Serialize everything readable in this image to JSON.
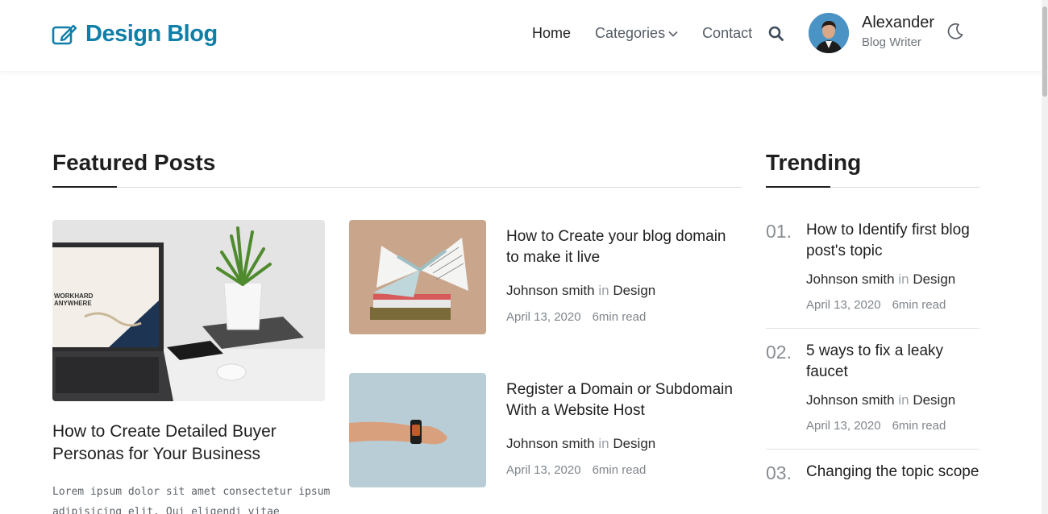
{
  "brand": {
    "name": "Design Blog",
    "icon": "edit-square-icon",
    "color": "#0f7fa8"
  },
  "nav": {
    "items": [
      {
        "label": "Home"
      },
      {
        "label": "Categories",
        "icon": "chevron-down-icon"
      },
      {
        "label": "Contact"
      }
    ],
    "search_icon": "search-icon"
  },
  "user": {
    "name": "Alexander",
    "role": "Blog Writer",
    "theme_icon": "moon-icon"
  },
  "featured": {
    "heading": "Featured Posts",
    "main": {
      "title": "How to Create Detailed Buyer Personas for Your Business",
      "excerpt": "Lorem ipsum dolor sit amet consectetur ipsum adipisicing elit. Qui eligendi vitae",
      "laptop_screen_text": "WORKHARD ANYWHERE"
    },
    "posts": [
      {
        "title": "How to Create your blog domain to make it live",
        "author": "Johnson smith",
        "in": "in",
        "category": "Design",
        "date": "April 13, 2020",
        "read": "6min read"
      },
      {
        "title": "Register a Domain or Subdomain With a Website Host",
        "author": "Johnson smith",
        "in": "in",
        "category": "Design",
        "date": "April 13, 2020",
        "read": "6min read"
      }
    ]
  },
  "trending": {
    "heading": "Trending",
    "items": [
      {
        "num": "01.",
        "title": "How to Identify first blog post's topic",
        "author": "Johnson smith",
        "in": "in",
        "category": "Design",
        "date": "April 13, 2020",
        "read": "6min read"
      },
      {
        "num": "02.",
        "title": "5 ways to fix a leaky faucet",
        "author": "Johnson smith",
        "in": "in",
        "category": "Design",
        "date": "April 13, 2020",
        "read": "6min read"
      },
      {
        "num": "03.",
        "title": "Changing the topic scope"
      }
    ]
  }
}
